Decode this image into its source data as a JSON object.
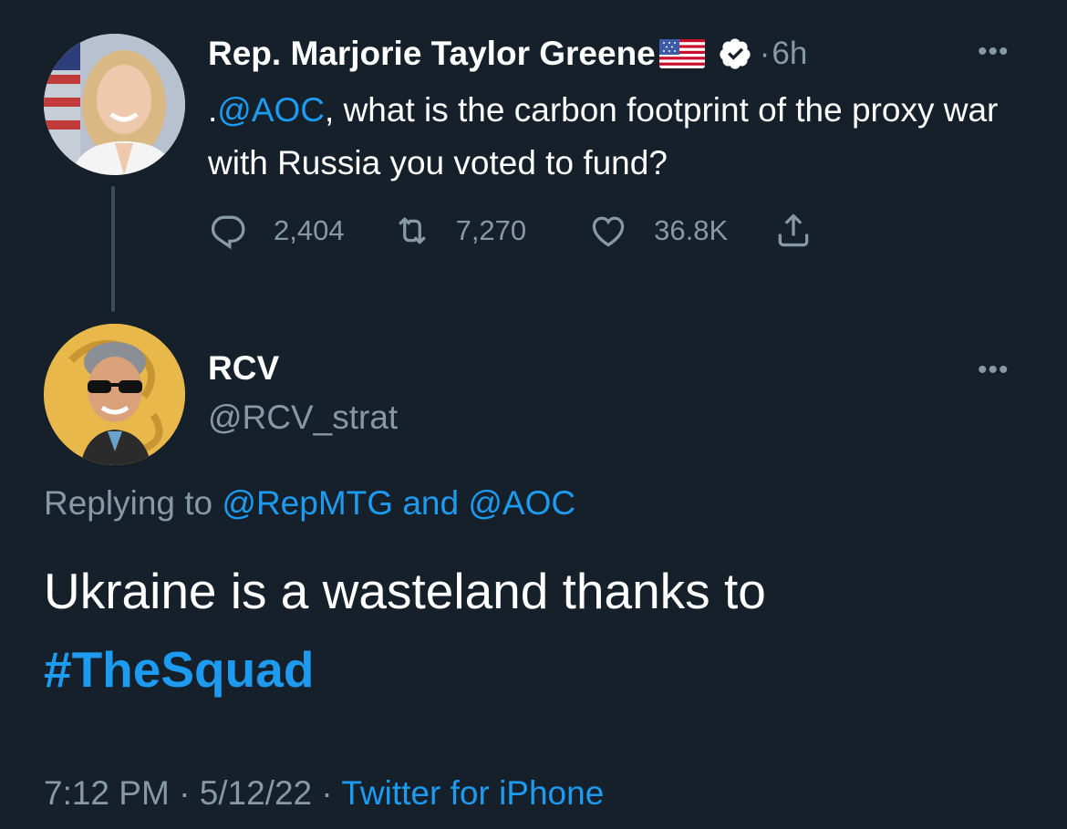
{
  "parent_tweet": {
    "display_name": "Rep. Marjorie Taylor Greene",
    "flag_icon": "us-flag-icon",
    "verified_icon": "verified-badge-icon",
    "separator": "·",
    "time_ago": "6h",
    "more_icon": "more-options-icon",
    "text_prefix": ".",
    "mention": "@AOC",
    "text_rest": ", what is the carbon footprint of the proxy war with Russia you voted to fund?",
    "stats": {
      "replies": "2,404",
      "retweets": "7,270",
      "likes": "36.8K"
    }
  },
  "reply_tweet": {
    "display_name": "RCV",
    "handle": "@RCV_strat",
    "more_icon": "more-options-icon",
    "replying_prefix": "Replying to",
    "replying_user_1": "@RepMTG",
    "replying_and": "and",
    "replying_user_2": "@AOC",
    "body_text": "Ukraine is a wasteland thanks to",
    "hashtag": "#TheSquad",
    "time": "7:12 PM",
    "date": "5/12/22",
    "separator": "·",
    "source": "Twitter for iPhone"
  },
  "colors": {
    "background": "#15202b",
    "link_blue": "#1d9bf0",
    "secondary_text": "#8899a6"
  }
}
